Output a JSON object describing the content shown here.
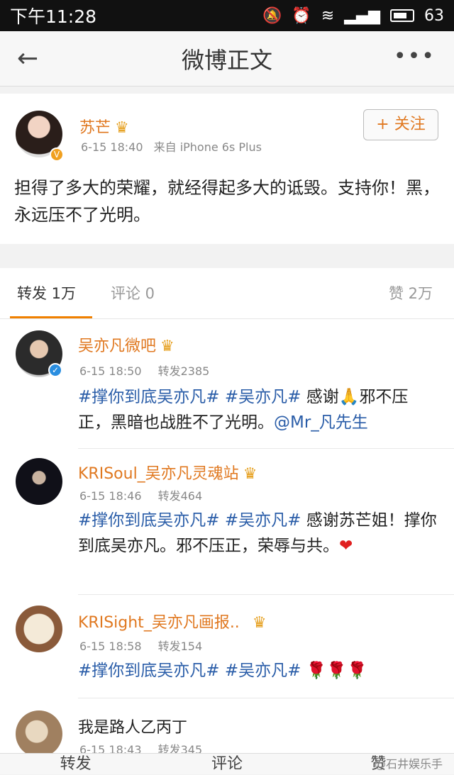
{
  "status": {
    "time": "下午11:28",
    "battery": "63"
  },
  "nav": {
    "title": "微博正文",
    "back": "←",
    "more": "•••"
  },
  "post": {
    "author": "苏芒",
    "time": "6-15 18:40",
    "source": "来自 iPhone 6s Plus",
    "follow_label": "+ 关注",
    "content": "担得了多大的荣耀，就经得起多大的诋毁。支持你！黑，永远压不了光明。"
  },
  "tabs": {
    "repost": "转发 1万",
    "comment": "评论 0",
    "like": "赞 2万"
  },
  "reposts": [
    {
      "name": "吴亦凡微吧",
      "time": "6-15 18:50",
      "repost": "转发2385",
      "text": "#撑你到底吴亦凡# #吴亦凡# 感谢🙏邪不压正，黑暗也战胜不了光明。@Mr_凡先生"
    },
    {
      "name": "KRISoul_吴亦凡灵魂站",
      "time": "6-15 18:46",
      "repost": "转发464",
      "text": "#撑你到底吴亦凡# #吴亦凡# 感谢苏芒姐！撑你到底吴亦凡。邪不压正，荣辱与共。❤"
    },
    {
      "name": "KRISight_吴亦凡画报..",
      "time": "6-15 18:58",
      "repost": "转发154",
      "text": "#撑你到底吴亦凡# #吴亦凡# 🌹🌹🌹"
    },
    {
      "name": "我是路人乙丙丁",
      "time": "6-15 18:43",
      "repost": "转发345",
      "text": ""
    }
  ],
  "bottom": {
    "repost": "转发",
    "comment": "评论",
    "like": "赞"
  },
  "watermark": "@石井娱乐手"
}
